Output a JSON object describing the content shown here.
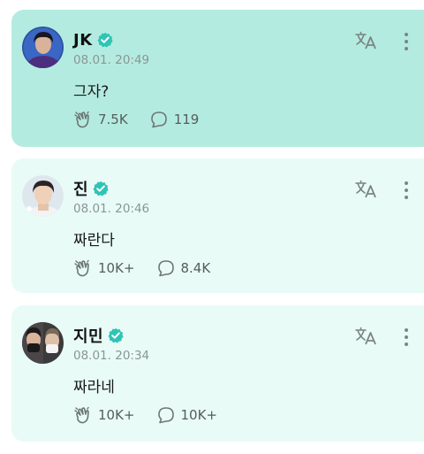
{
  "posts": [
    {
      "author": "JK",
      "verified": true,
      "timestamp": "08.01. 20:49",
      "message": "그자?",
      "likes": "7.5K",
      "comments": "119",
      "highlighted": true
    },
    {
      "author": "진",
      "verified": true,
      "timestamp": "08.01. 20:46",
      "message": "짜란다",
      "likes": "10K+",
      "comments": "8.4K",
      "highlighted": false
    },
    {
      "author": "지민",
      "verified": true,
      "timestamp": "08.01. 20:34",
      "message": "짜라네",
      "likes": "10K+",
      "comments": "10K+",
      "highlighted": false
    }
  ],
  "colors": {
    "highlight_card": "#b4ebe0",
    "card": "#e8fbf7",
    "verified_badge": "#2ec4b6",
    "icon_gray": "#6d7775"
  },
  "icons": {
    "verified": "verified-badge-icon",
    "translate": "translate-icon",
    "more": "more-vertical-icon",
    "like": "applause-hand-icon",
    "comment": "comment-bubble-icon"
  }
}
